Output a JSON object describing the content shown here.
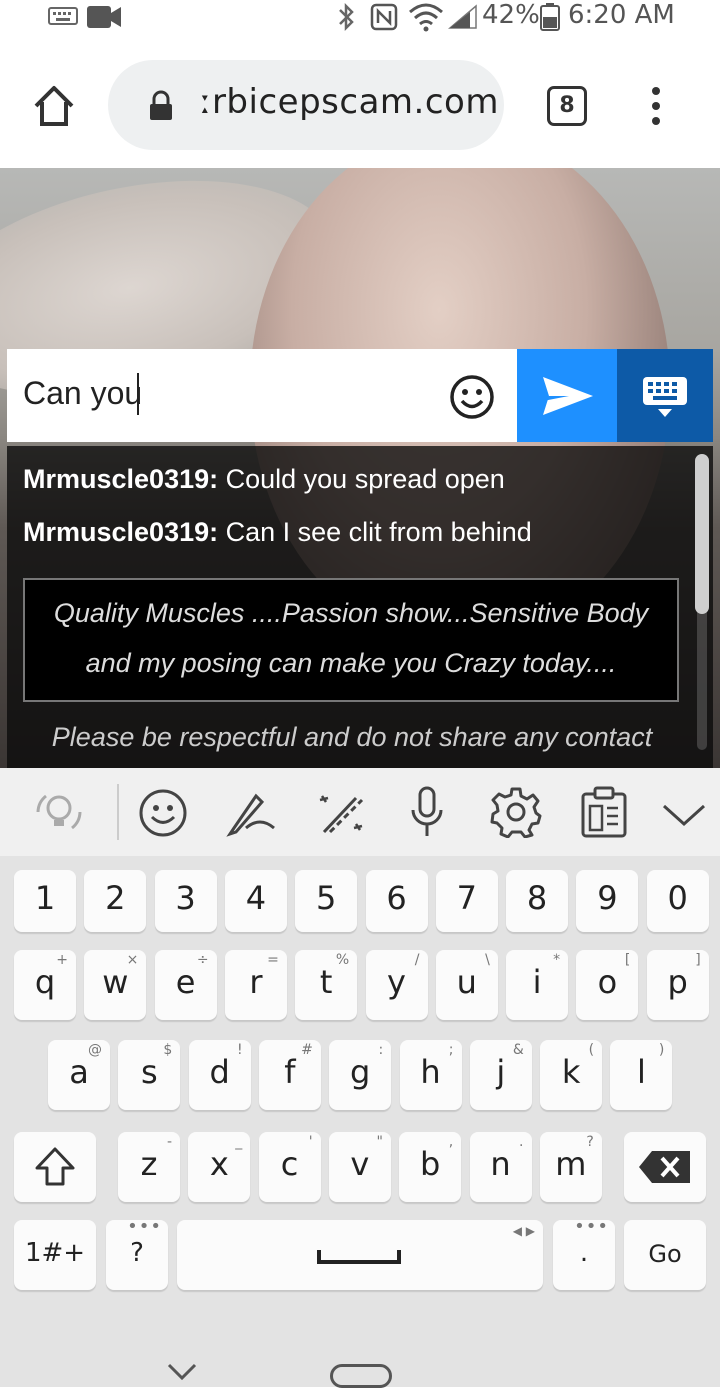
{
  "status_bar": {
    "battery": "42%",
    "time": "6:20 AM"
  },
  "browser": {
    "url": "ːrbicepscam.com",
    "tab_count": "8"
  },
  "chat": {
    "input_value": "Can you",
    "messages": [
      {
        "user": "Mrmuscle0319:",
        "text": " Could you spread open"
      },
      {
        "user": "Mrmuscle0319:",
        "text": " Can I see clit from behind"
      }
    ],
    "notice_line1": "Quality Muscles ....Passion show...Sensitive Body",
    "notice_line2": "and my posing can make you Crazy today....",
    "rules": "Please be respectful and do not share any contact"
  },
  "keyboard": {
    "number_row": [
      "1",
      "2",
      "3",
      "4",
      "5",
      "6",
      "7",
      "8",
      "9",
      "0"
    ],
    "row1": [
      {
        "k": "q",
        "h": "+"
      },
      {
        "k": "w",
        "h": "×"
      },
      {
        "k": "e",
        "h": "÷"
      },
      {
        "k": "r",
        "h": "="
      },
      {
        "k": "t",
        "h": "%"
      },
      {
        "k": "y",
        "h": "/"
      },
      {
        "k": "u",
        "h": "\\"
      },
      {
        "k": "i",
        "h": "*"
      },
      {
        "k": "o",
        "h": "["
      },
      {
        "k": "p",
        "h": "]"
      }
    ],
    "row2": [
      {
        "k": "a",
        "h": "@"
      },
      {
        "k": "s",
        "h": "$"
      },
      {
        "k": "d",
        "h": "!"
      },
      {
        "k": "f",
        "h": "#"
      },
      {
        "k": "g",
        "h": ":"
      },
      {
        "k": "h",
        "h": ";"
      },
      {
        "k": "j",
        "h": "&"
      },
      {
        "k": "k",
        "h": "("
      },
      {
        "k": "l",
        "h": ")"
      }
    ],
    "row3": [
      {
        "k": "z",
        "h": "-"
      },
      {
        "k": "x",
        "h": "_"
      },
      {
        "k": "c",
        "h": "'"
      },
      {
        "k": "v",
        "h": "\""
      },
      {
        "k": "b",
        "h": ","
      },
      {
        "k": "n",
        "h": "."
      },
      {
        "k": "m",
        "h": "?"
      }
    ],
    "symbols_label": "1#+",
    "question_label": "?",
    "period_label": ".",
    "go_label": "Go"
  },
  "icons": {
    "status": [
      "keyboard-icon",
      "video-icon",
      "bluetooth-icon",
      "nfc-icon",
      "wifi-icon",
      "signal-icon",
      "battery-icon"
    ],
    "toolbar": [
      "lightbulb-icon",
      "emoji-icon",
      "handwriting-icon",
      "magic-icon",
      "mic-icon",
      "settings-icon",
      "clipboard-icon",
      "chevron-down-icon"
    ]
  },
  "colors": {
    "send": "#1e90ff",
    "keyboard_toggle": "#0d5aa7"
  }
}
